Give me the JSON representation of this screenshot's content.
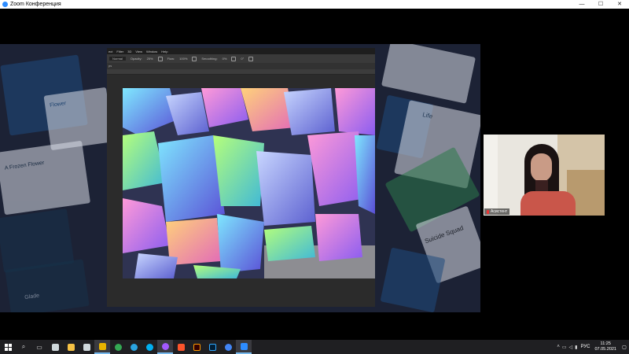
{
  "window": {
    "title": "Zoom Конференция",
    "minimize_glyph": "—",
    "maximize_glyph": "☐",
    "close_glyph": "✕"
  },
  "shared_screen": {
    "app_menu": [
      "ect",
      "Filter",
      "3D",
      "View",
      "Window",
      "Help"
    ],
    "options_bar": {
      "mode": "Normal",
      "opacity_label": "Opacity:",
      "opacity_value": "25%",
      "flow_label": "Flow:",
      "flow_value": "100%",
      "smoothing_label": "Smoothing:",
      "smoothing_value": "0%",
      "angle_value": "0°"
    },
    "document_tab": "ps",
    "background_cards": [
      "Flower",
      "A Frozen Flower",
      "Life",
      "Suicide Squad",
      "Glade"
    ]
  },
  "participant": {
    "name": "Асистент",
    "mic_muted": true
  },
  "taskbar": {
    "apps": [
      {
        "icon": "search-icon",
        "color": "#ffffff"
      },
      {
        "icon": "task-view-icon",
        "color": "#ffffff"
      },
      {
        "icon": "calculator-icon",
        "color": "#cfd8dc"
      },
      {
        "icon": "file-explorer-icon",
        "color": "#f6c244"
      },
      {
        "icon": "save-icon",
        "color": "#cfd8dc"
      },
      {
        "icon": "cinema-icon",
        "color": "#e8b400"
      },
      {
        "icon": "chrome-icon",
        "color": "#34a853"
      },
      {
        "icon": "telegram-icon",
        "color": "#2aa3e0"
      },
      {
        "icon": "skype-icon",
        "color": "#00aff0"
      },
      {
        "icon": "messenger-icon",
        "color": "#a259ff"
      },
      {
        "icon": "brave-icon",
        "color": "#fb542b"
      },
      {
        "icon": "illustrator-icon",
        "color": "#ff9a00"
      },
      {
        "icon": "photoshop-icon",
        "color": "#31a8ff"
      },
      {
        "icon": "chrome-alt-icon",
        "color": "#4285f4"
      },
      {
        "icon": "zoom-icon",
        "color": "#2d8cff"
      }
    ],
    "language": "РУС",
    "time": "11:25",
    "date": "07.05.2021"
  }
}
